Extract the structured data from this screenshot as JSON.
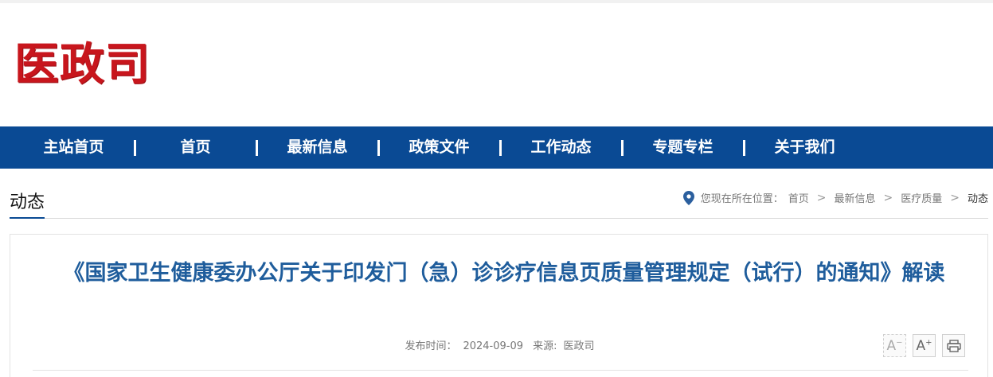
{
  "site": {
    "logo_text": "医政司"
  },
  "nav": {
    "items": [
      {
        "label": "主站首页"
      },
      {
        "label": "首页"
      },
      {
        "label": "最新信息"
      },
      {
        "label": "政策文件"
      },
      {
        "label": "工作动态"
      },
      {
        "label": "专题专栏"
      },
      {
        "label": "关于我们"
      }
    ]
  },
  "section": {
    "title": "动态"
  },
  "breadcrumb": {
    "prefix": "您现在所在位置：",
    "items": [
      "首页",
      "最新信息",
      "医疗质量"
    ],
    "current": "动态",
    "separator": ">"
  },
  "article": {
    "title": "《国家卫生健康委办公厅关于印发门（急）诊诊疗信息页质量管理规定（试行）的通知》解读",
    "publish_label": "发布时间：",
    "publish_date": "2024-09-09",
    "source_label": "来源:",
    "source": "医政司"
  },
  "tools": {
    "font_decrease": "A",
    "font_increase": "A",
    "minus": "−",
    "plus": "+"
  },
  "colors": {
    "nav_bg": "#0a4a94",
    "logo": "#c8161d",
    "title": "#1f5d9c"
  }
}
